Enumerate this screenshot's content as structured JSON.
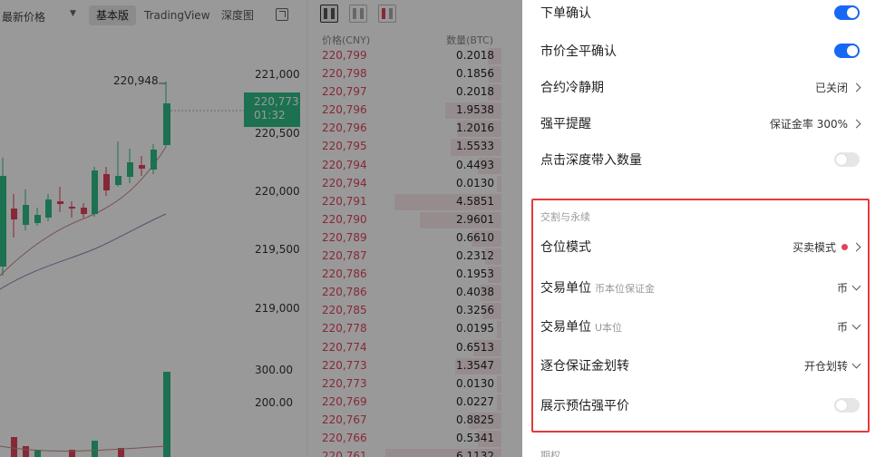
{
  "chart": {
    "price_type": "最新价格",
    "tabs": [
      "基本版",
      "TradingView",
      "深度图"
    ],
    "active_tab": "基本版",
    "y_ticks": [
      "221,000",
      "220,500",
      "220,000",
      "219,500",
      "219,000"
    ],
    "vol_ticks": [
      "300.00",
      "200.00"
    ],
    "current_price": "220,773",
    "countdown": "01:32",
    "high_label": "220,948",
    "up_color": "#2ebd85",
    "down_color": "#e2445c"
  },
  "orderbook": {
    "price_header": "价格(CNY)",
    "qty_header": "数量(BTC)",
    "rows": [
      {
        "price": "220,799",
        "qty": "0.2018"
      },
      {
        "price": "220,798",
        "qty": "0.1856"
      },
      {
        "price": "220,797",
        "qty": "0.2018"
      },
      {
        "price": "220,796",
        "qty": "1.9538"
      },
      {
        "price": "220,796",
        "qty": "1.2016"
      },
      {
        "price": "220,795",
        "qty": "1.5533"
      },
      {
        "price": "220,794",
        "qty": "0.4493"
      },
      {
        "price": "220,794",
        "qty": "0.0130"
      },
      {
        "price": "220,791",
        "qty": "4.5851"
      },
      {
        "price": "220,790",
        "qty": "2.9601"
      },
      {
        "price": "220,789",
        "qty": "0.6610"
      },
      {
        "price": "220,787",
        "qty": "0.2312"
      },
      {
        "price": "220,786",
        "qty": "0.1953"
      },
      {
        "price": "220,786",
        "qty": "0.4038"
      },
      {
        "price": "220,785",
        "qty": "0.3256"
      },
      {
        "price": "220,778",
        "qty": "0.0195"
      },
      {
        "price": "220,774",
        "qty": "0.6513"
      },
      {
        "price": "220,773",
        "qty": "1.3547"
      },
      {
        "price": "220,773",
        "qty": "0.0130"
      },
      {
        "price": "220,769",
        "qty": "0.0227"
      },
      {
        "price": "220,767",
        "qty": "0.8825"
      },
      {
        "price": "220,766",
        "qty": "0.5341"
      },
      {
        "price": "220,761",
        "qty": "6.1132"
      }
    ]
  },
  "settings": {
    "order_confirm": {
      "label": "下单确认",
      "on": true
    },
    "market_close_confirm": {
      "label": "市价全平确认",
      "on": true
    },
    "cooldown": {
      "label": "合约冷静期",
      "value": "已关闭"
    },
    "liq_alert": {
      "label": "强平提醒",
      "value": "保证金率 300%"
    },
    "depth_click": {
      "label": "点击深度带入数量",
      "on": false
    },
    "section_title": "交割与永续",
    "position_mode": {
      "label": "仓位模式",
      "value": "买卖模式"
    },
    "unit_coin": {
      "label": "交易单位",
      "sub": "币本位保证金",
      "value": "币"
    },
    "unit_u": {
      "label": "交易单位",
      "sub": "U本位",
      "value": "币"
    },
    "margin_transfer": {
      "label": "逐仓保证金划转",
      "value": "开仓划转"
    },
    "show_liq_price": {
      "label": "展示预估强平价",
      "on": false
    },
    "next_section": "期权",
    "accent_color": "#1769f5",
    "highlight_color": "#e23b3b"
  }
}
